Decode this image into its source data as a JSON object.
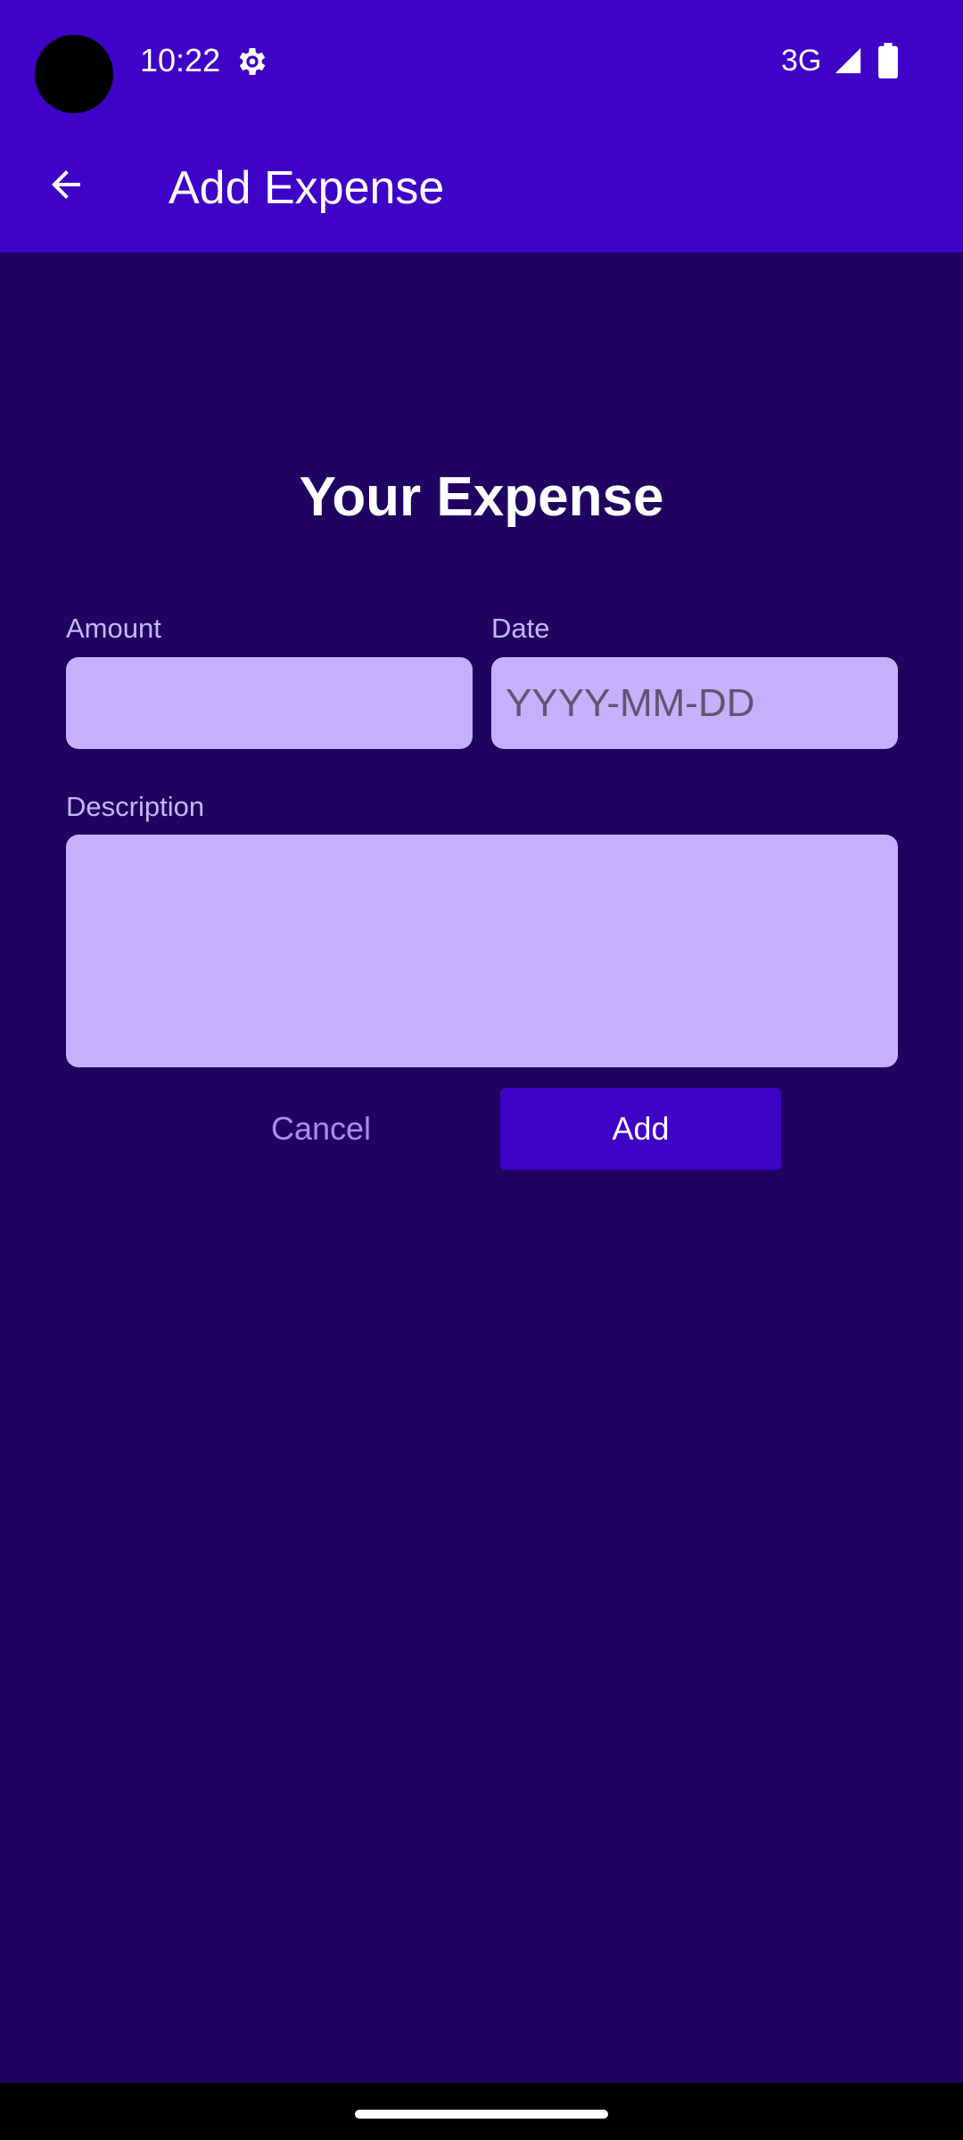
{
  "status_bar": {
    "time": "10:22",
    "network": "3G",
    "icons": [
      "gear-icon",
      "signal-icon",
      "battery-icon"
    ]
  },
  "app_bar": {
    "title": "Add Expense",
    "back_icon": "arrow-back-icon"
  },
  "form": {
    "heading": "Your Expense",
    "amount": {
      "label": "Amount",
      "value": "",
      "placeholder": ""
    },
    "date": {
      "label": "Date",
      "value": "",
      "placeholder": "YYYY-MM-DD"
    },
    "description": {
      "label": "Description",
      "value": "",
      "placeholder": ""
    },
    "cancel_label": "Cancel",
    "add_label": "Add"
  },
  "colors": {
    "app_bar": "#3f02c7",
    "background": "#200261",
    "field_fill": "#c6b0fb",
    "label_text": "#c8b6f9",
    "cancel_text": "#a98cf2"
  }
}
